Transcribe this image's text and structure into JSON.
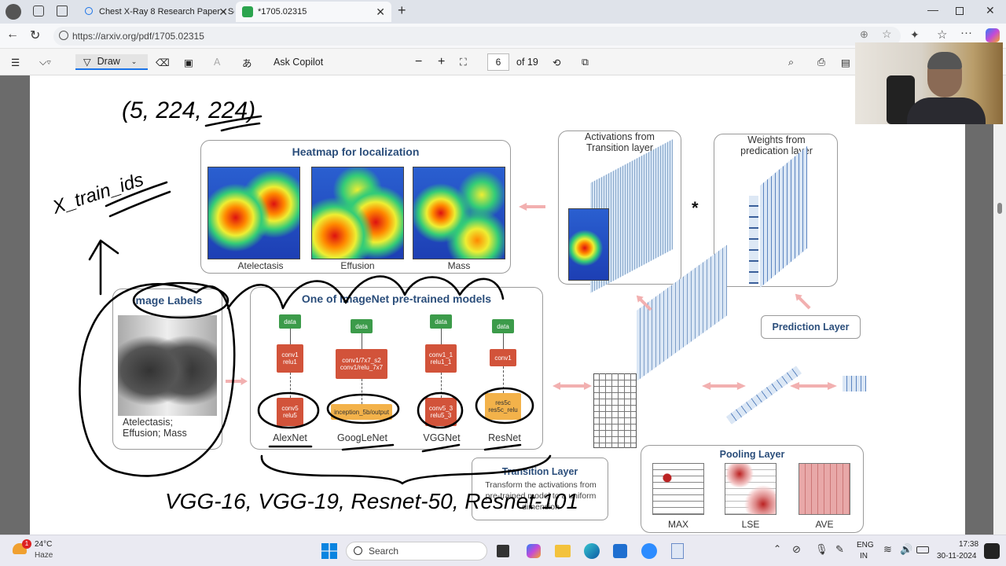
{
  "browser": {
    "tabs": [
      {
        "title": "Chest X-Ray 8 Research Paper - Se",
        "active": false
      },
      {
        "title": "*1705.02315",
        "active": true
      }
    ],
    "url": "https://arxiv.org/pdf/1705.02315"
  },
  "pdf_toolbar": {
    "draw_label": "Draw",
    "ask_copilot": "Ask Copilot",
    "page_current": "6",
    "page_total": "of 19"
  },
  "figure": {
    "heatmap_title": "Heatmap for localization",
    "heatmap_labels": [
      "Atelectasis",
      "Effusion",
      "Mass"
    ],
    "activations_title": "Activations from Transition layer",
    "weights_title": "Weights from predication layer",
    "multiply_symbol": "*",
    "image_labels_title": "Image Labels",
    "image_labels_text": "Atelectasis; Effusion; Mass",
    "models_title": "One of ImageNet pre-trained models",
    "models": [
      {
        "name": "AlexNet",
        "nodes": [
          "data",
          "conv1\nrelu1",
          "conv5\nrelu5"
        ]
      },
      {
        "name": "GoogLeNet",
        "nodes": [
          "data",
          "conv1/7x7_s2\nconv1/relu_7x7",
          "inception_5b/output"
        ]
      },
      {
        "name": "VGGNet",
        "nodes": [
          "data",
          "conv1_1\nrelu1_1",
          "conv5_3\nrelu5_3"
        ]
      },
      {
        "name": "ResNet",
        "nodes": [
          "data",
          "conv1",
          "res5c\nres5c_relu"
        ]
      }
    ],
    "prediction_layer": "Prediction Layer",
    "transition_title": "Transition Layer",
    "transition_text": "Transform the activations from pre-trained model to a uniform dimension",
    "pooling_title": "Pooling Layer",
    "pooling_labels": [
      "MAX",
      "LSE",
      "AVE"
    ]
  },
  "annotations": {
    "dims": "(5, 224, 224)",
    "xtrain": "X_train_ids",
    "models_written": "VGG-16, VGG-19, Resnet-50, Resnet-101"
  },
  "taskbar": {
    "weather_temp": "24°C",
    "weather_desc": "Haze",
    "weather_badge": "1",
    "search_label": "Search",
    "lang": "ENG",
    "region": "IN",
    "time": "17:38",
    "date": "30-11-2024"
  }
}
